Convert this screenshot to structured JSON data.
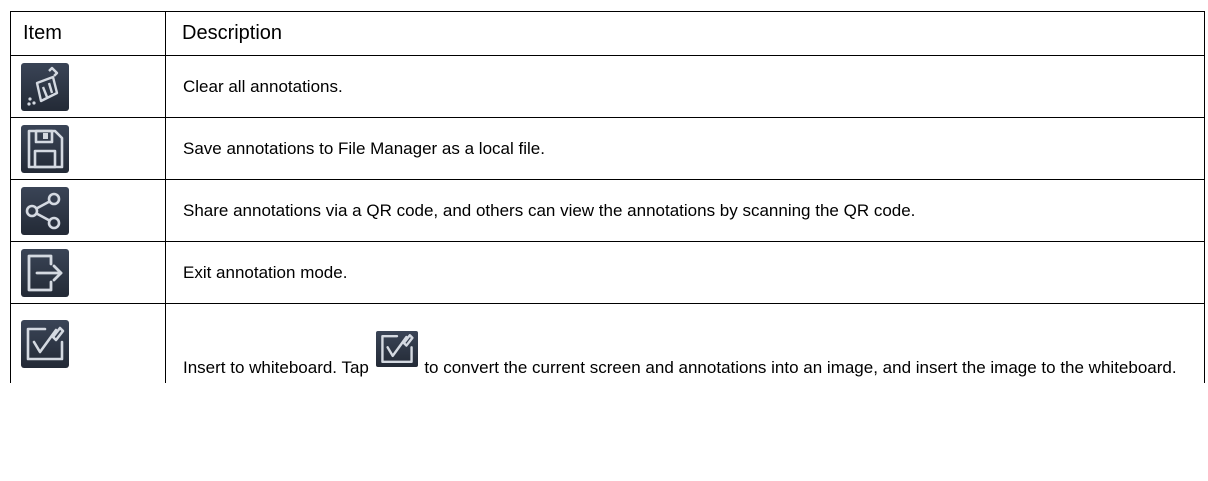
{
  "header": {
    "item": "Item",
    "description": "Description"
  },
  "rows": [
    {
      "icon": "broom-icon",
      "description": "Clear all annotations."
    },
    {
      "icon": "save-icon",
      "description": "Save annotations to File Manager as a local file."
    },
    {
      "icon": "share-icon",
      "description": "Share annotations via a QR code, and others can view the annotations by scanning the QR code."
    },
    {
      "icon": "exit-icon",
      "description": "Exit annotation mode."
    },
    {
      "icon": "insert-whiteboard-icon",
      "description_part1": "Insert to whiteboard. Tap",
      "description_part2": "to convert the current screen and annotations into an image, and insert the image to the whiteboard."
    }
  ],
  "colors": {
    "icon_bg": "#2c3441",
    "icon_fg": "#c9d0da",
    "accent": "#4a8fd6"
  }
}
